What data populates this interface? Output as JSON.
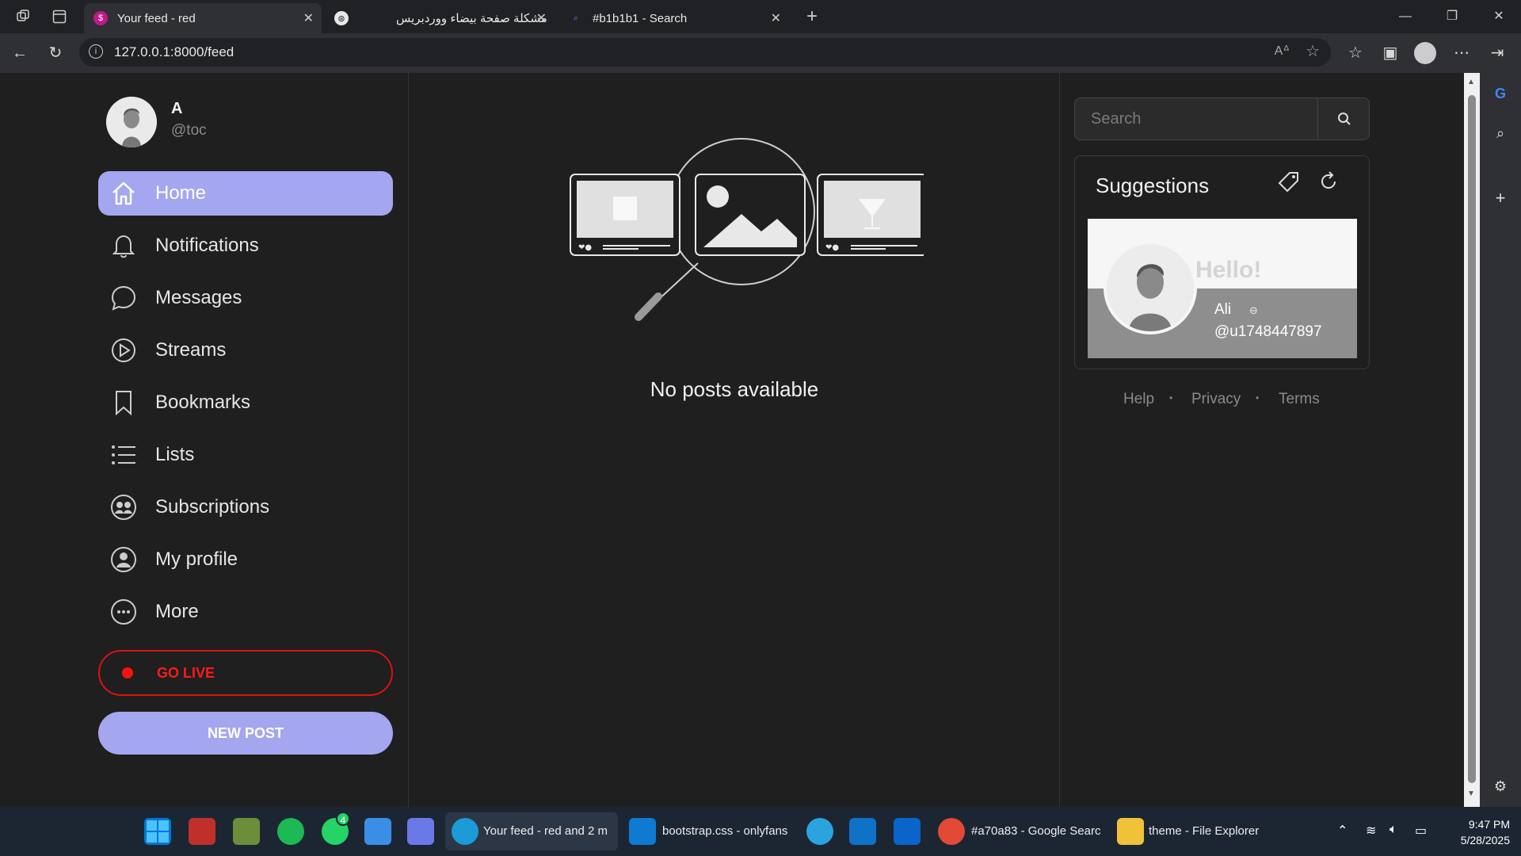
{
  "browser": {
    "tabs": [
      {
        "title": "Your feed - red",
        "active": true
      },
      {
        "title": "مشكلة صفحة بيضاء ووردبريس",
        "active": false
      },
      {
        "title": "#b1b1b1 - Search",
        "active": false
      }
    ],
    "url": "127.0.0.1:8000/feed",
    "new_tab_icon": "plus-icon"
  },
  "profile": {
    "name": "A",
    "handle": "@toc"
  },
  "nav": {
    "items": [
      {
        "label": "Home",
        "icon": "home-icon",
        "active": true
      },
      {
        "label": "Notifications",
        "icon": "bell-icon"
      },
      {
        "label": "Messages",
        "icon": "chat-bubble-icon"
      },
      {
        "label": "Streams",
        "icon": "play-circle-icon"
      },
      {
        "label": "Bookmarks",
        "icon": "bookmark-icon"
      },
      {
        "label": "Lists",
        "icon": "list-icon"
      },
      {
        "label": "Subscriptions",
        "icon": "subscriptions-icon"
      },
      {
        "label": "My profile",
        "icon": "user-circle-icon"
      },
      {
        "label": "More",
        "icon": "more-circle-icon"
      }
    ],
    "go_live": "GO LIVE",
    "new_post": "NEW POST"
  },
  "feed": {
    "empty_message": "No posts available"
  },
  "sidebar": {
    "search_placeholder": "Search",
    "suggestions_title": "Suggestions",
    "suggestion": {
      "name": "Ali",
      "handle": "@u1748447897",
      "cover_text": "Hello!"
    },
    "footer": [
      "Help",
      "Privacy",
      "Terms"
    ]
  },
  "taskbar": {
    "items": [
      {
        "label": "Your feed - red and 2 m"
      },
      {
        "label": "bootstrap.css - onlyfans"
      },
      {
        "label": "#a70a83 - Google Searc"
      },
      {
        "label": "theme - File Explorer"
      }
    ],
    "whatsapp_badge": "4",
    "time": "9:47 PM",
    "date": "5/28/2025"
  },
  "colors": {
    "accent": "#a5a6f0",
    "live_red": "#ff1a1a",
    "background": "#1f1f1f"
  }
}
